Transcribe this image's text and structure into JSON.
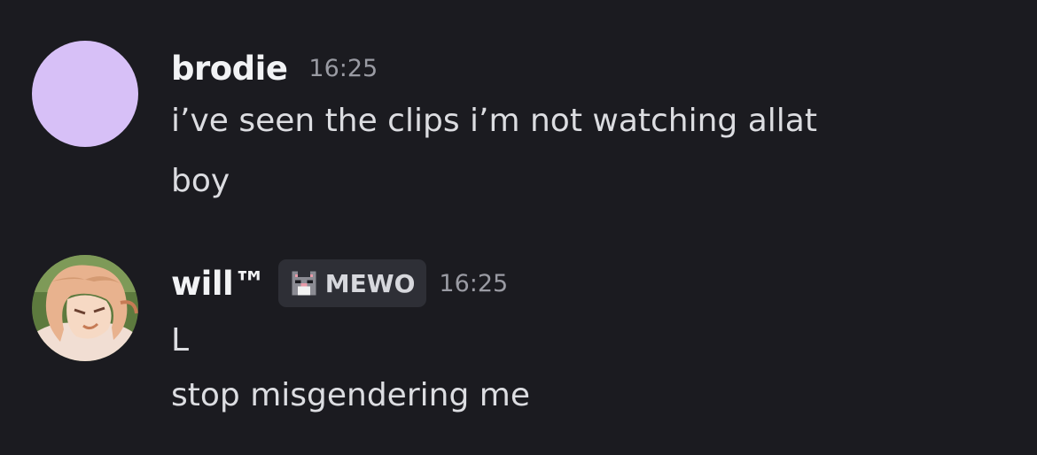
{
  "messages": [
    {
      "username": "brodie",
      "timestamp": "16:25",
      "avatar": {
        "type": "solid",
        "color": "#d7c0f7"
      },
      "lines": [
        "i’ve seen the clips i’m not watching allat",
        "boy"
      ]
    },
    {
      "username": "will™",
      "timestamp": "16:25",
      "avatar": {
        "type": "illustration",
        "palette": [
          "#5d7a3e",
          "#e8b28e",
          "#f1ded3",
          "#c67b55"
        ]
      },
      "tag": {
        "label": "MEWO",
        "icon": "pixel-cat-icon"
      },
      "lines": [
        "L",
        "stop misgendering me"
      ]
    }
  ],
  "colors": {
    "background": "#1b1b20",
    "username": "#f2f3f5",
    "timestamp": "#9a9ba3",
    "message_text": "#dcdde1",
    "tag_background": "#2e2f36"
  }
}
